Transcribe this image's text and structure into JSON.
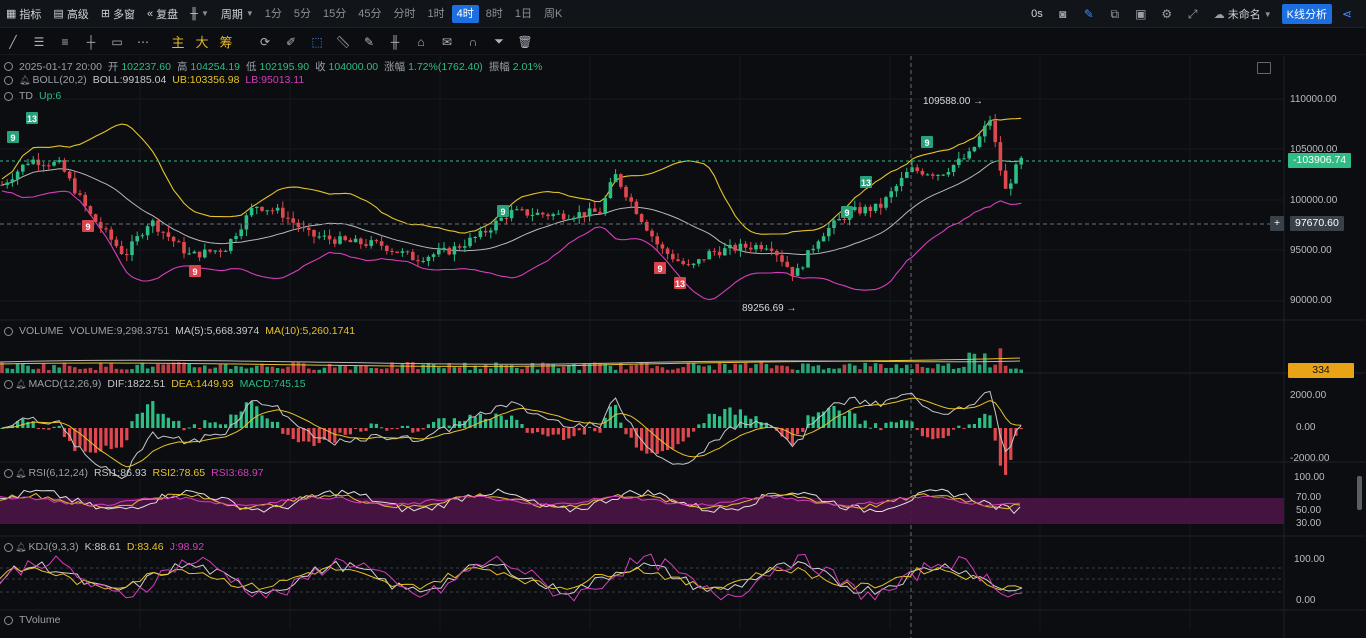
{
  "toolbar": {
    "indicator": "指标",
    "advanced": "高级",
    "multi_window": "多窗",
    "replay": "复盘",
    "period": "周期",
    "timeframes": [
      "1分",
      "5分",
      "15分",
      "45分",
      "分时",
      "1时",
      "4时",
      "8时",
      "1日",
      "周K"
    ],
    "active_timeframe": "4时",
    "countdown": "0s",
    "layout_name": "未命名",
    "k_analysis": "K线分析"
  },
  "drawtools": [
    "trendline-icon",
    "hlines-icon",
    "channel-icon",
    "cross-icon",
    "rect-icon",
    "more-icon",
    "主",
    "大",
    "筹",
    "sync-icon",
    "brush-icon",
    "select-icon",
    "ruler-icon",
    "pen-icon",
    "candle-icon",
    "bag-icon",
    "note-icon",
    "magnet-icon",
    "filter-icon",
    "trash-icon"
  ],
  "ohlc": {
    "datetime": "2025-01-17 20:00",
    "open_label": "开",
    "open": "102237.60",
    "high_label": "高",
    "high": "104254.19",
    "low_label": "低",
    "low": "102195.90",
    "close_label": "收",
    "close": "104000.00",
    "change_label": "涨幅",
    "change": "1.72%(1762.40)",
    "amp_label": "振幅",
    "amp": "2.01%"
  },
  "boll": {
    "name": "BOLL(20,2)",
    "boll": "BOLL:99185.04",
    "ub": "UB:103356.98",
    "lb": "LB:95013.11"
  },
  "td": {
    "name": "TD",
    "up": "Up:6"
  },
  "price_axis": [
    "110000.00",
    "105000.00",
    "100000.00",
    "95000.00",
    "90000.00"
  ],
  "current_price": "103906.74",
  "crosshair_price": "97670.60",
  "annotations": {
    "high": "109588.00",
    "low": "89256.69"
  },
  "volume": {
    "name": "VOLUME",
    "vol": "VOLUME:9,298.3751",
    "ma5": "MA(5):5,668.3974",
    "ma10": "MA(10):5,260.1741",
    "axis_tag": "334"
  },
  "macd": {
    "name": "MACD(12,26,9)",
    "dif": "DIF:1822.51",
    "dea": "DEA:1449.93",
    "macd": "MACD:745.15",
    "axis": [
      "2000.00",
      "0.00",
      "-2000.00"
    ]
  },
  "rsi": {
    "name": "RSI(6,12,24)",
    "rsi1": "RSI1:86.93",
    "rsi2": "RSI2:78.65",
    "rsi3": "RSI3:68.97",
    "axis": [
      "100.00",
      "70.00",
      "50.00",
      "30.00"
    ]
  },
  "kdj": {
    "name": "KDJ(9,3,3)",
    "k": "K:88.61",
    "d": "D:83.46",
    "j": "J:98.92",
    "axis": [
      "100.00",
      "0.00"
    ]
  },
  "tvolume": {
    "name": "TVolume"
  },
  "td_markers": [
    {
      "label": "9",
      "type": "up"
    },
    {
      "label": "13",
      "type": "up"
    },
    {
      "label": "9",
      "type": "down"
    },
    {
      "label": "9",
      "type": "down"
    },
    {
      "label": "9",
      "type": "up"
    },
    {
      "label": "9",
      "type": "down"
    },
    {
      "label": "13",
      "type": "down"
    },
    {
      "label": "9",
      "type": "up"
    },
    {
      "label": "13",
      "type": "up"
    },
    {
      "label": "9",
      "type": "up"
    }
  ],
  "colors": {
    "up": "#2ebd85",
    "down": "#e0484f",
    "yellow": "#e6c229",
    "magenta": "#d63dbd",
    "white": "#c8c8c8",
    "accent": "#1d6fe0"
  }
}
